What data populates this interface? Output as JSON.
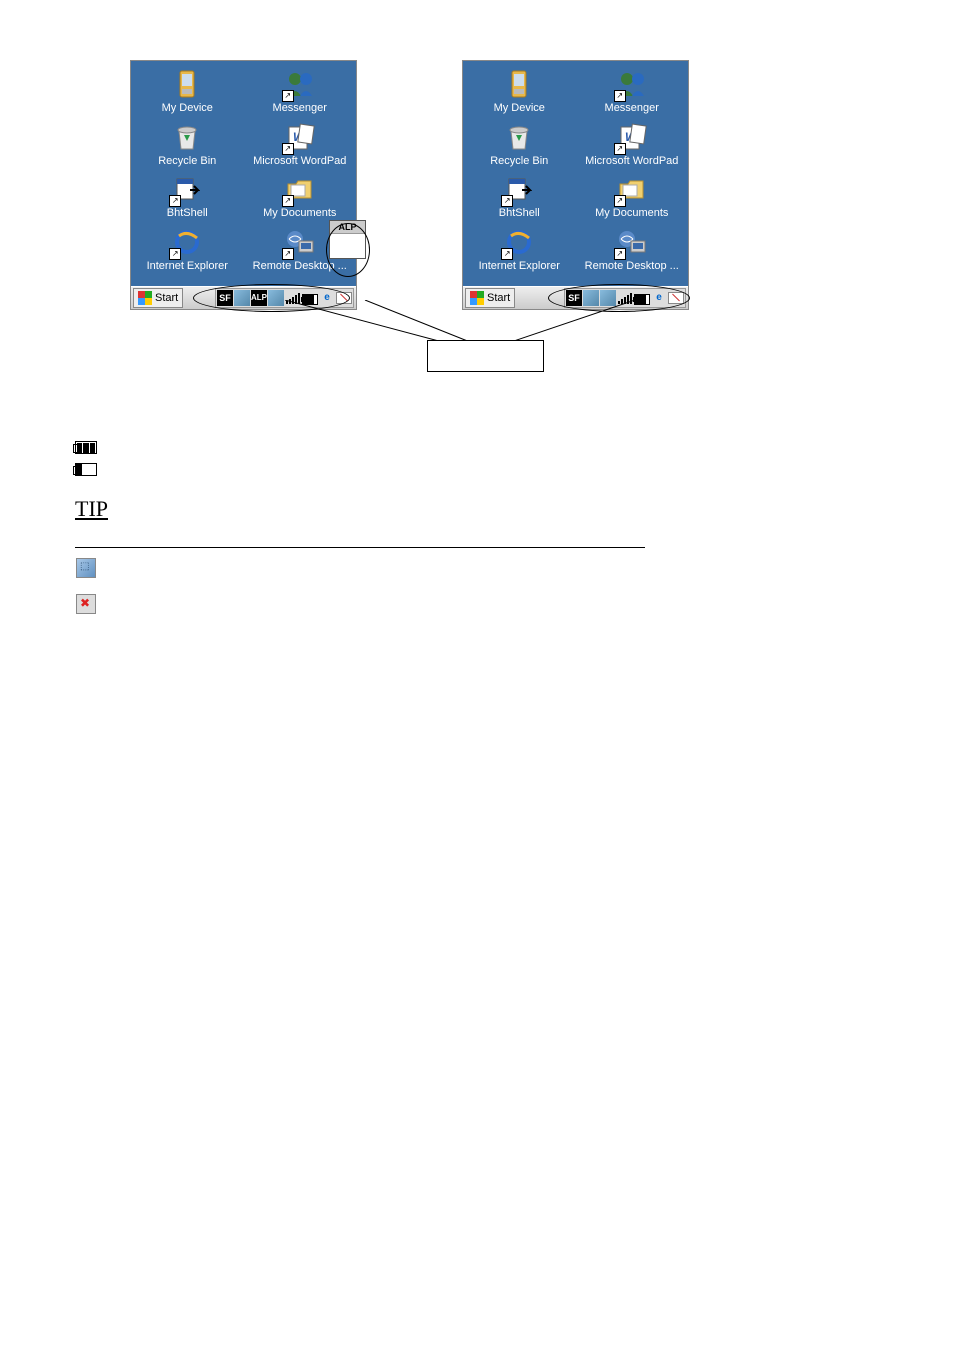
{
  "desktop": {
    "icons": {
      "my_device": "My Device",
      "messenger": "Messenger",
      "recycle_bin": "Recycle Bin",
      "wordpad": "Microsoft WordPad",
      "bhtshell": "BhtShell",
      "my_documents": "My Documents",
      "ie": "Internet Explorer",
      "remote_desktop": "Remote Desktop ..."
    },
    "start": "Start",
    "alp_popup": "ALP"
  },
  "callout": {
    "label": ""
  },
  "battery": {
    "title": "",
    "full": "",
    "low": "",
    "tip": "TIP",
    "tip_body": ""
  },
  "usb": {
    "connected": "",
    "disconnected": ""
  }
}
